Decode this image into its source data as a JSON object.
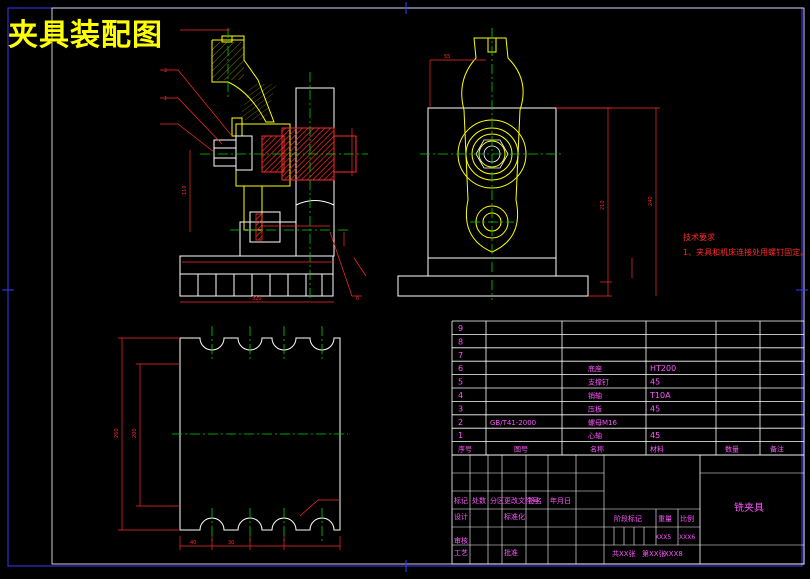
{
  "drawing": {
    "title": "夹具装配图",
    "tech_requirements": {
      "heading": "技术要求",
      "item1": "1、夹具和机床连接处用螺钉固定。"
    },
    "dimensions": {
      "front_width": "320",
      "front_height": "110",
      "side_height": "210",
      "side_overall": "240",
      "bottom_height": "260",
      "bottom_inner": "200",
      "bottom_pitch": "30",
      "bottom_left": "40",
      "top_offset": "55"
    },
    "callouts": [
      "1",
      "2",
      "6"
    ]
  },
  "bom": {
    "rows": [
      {
        "no": "9",
        "code": "",
        "name": "",
        "qty": "",
        "material": "",
        "note": ""
      },
      {
        "no": "8",
        "code": "",
        "name": "",
        "qty": "",
        "material": "",
        "note": ""
      },
      {
        "no": "7",
        "code": "",
        "name": "",
        "qty": "",
        "material": "",
        "note": ""
      },
      {
        "no": "6",
        "code": "",
        "name": "底座",
        "qty": "",
        "material": "HT200",
        "note": ""
      },
      {
        "no": "5",
        "code": "",
        "name": "支撑钉",
        "qty": "",
        "material": "45",
        "note": ""
      },
      {
        "no": "4",
        "code": "",
        "name": "销轴",
        "qty": "",
        "material": "T10A",
        "note": ""
      },
      {
        "no": "3",
        "code": "",
        "name": "压板",
        "qty": "",
        "material": "45",
        "note": ""
      },
      {
        "no": "2",
        "code": "GB/T41-2000",
        "name": "螺母M16",
        "qty": "",
        "material": "",
        "note": ""
      },
      {
        "no": "1",
        "code": "",
        "name": "心轴",
        "qty": "",
        "material": "45",
        "note": ""
      }
    ],
    "header": {
      "no": "序号",
      "code": "图号",
      "name": "名称",
      "qty": "数量",
      "material": "材料",
      "note": "备注"
    }
  },
  "titleblock": {
    "part_name": "铣夹具",
    "row1": [
      "标记",
      "处数",
      "分区",
      "更改文件号",
      "签名",
      "年月日"
    ],
    "design": "设计",
    "std": "标准化",
    "stage": "阶段标记",
    "weight": "重量",
    "scale": "比例",
    "scale_val": "XXX5",
    "weight_val": "XXX6",
    "review": "审核",
    "process": "工艺",
    "approve": "批准",
    "sheets": "共XX张",
    "sheet": "第XX张",
    "sheet_no": "XXX8"
  },
  "colors": {
    "outline": "#ffffff",
    "frame": "#3a3aff",
    "center": "#00d200",
    "dim": "#ff2a2a",
    "part": "#ffff00",
    "section": "#ff2a2a",
    "bomtext": "#ff55ff",
    "grid": "#00ffff"
  }
}
